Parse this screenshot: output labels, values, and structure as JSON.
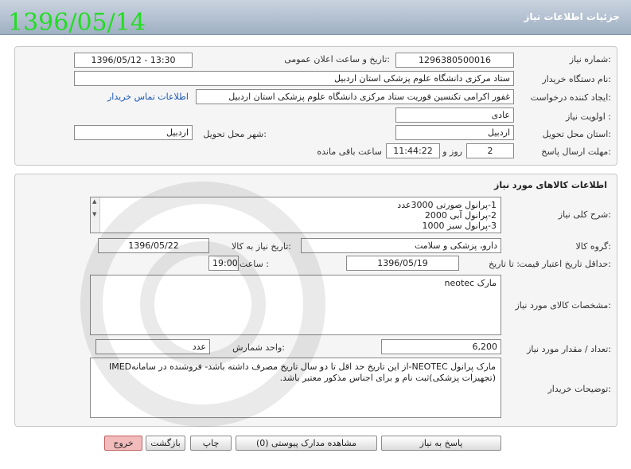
{
  "window": {
    "title": "جزئیات اطلاعات نیاز",
    "date_stamp": "1396/05/14"
  },
  "need": {
    "need_number_label": "شماره نیاز:",
    "need_number": "1296380500016",
    "announce_label": "تاریخ و ساعت اعلان عمومی:",
    "announce_value": "1396/05/12 - 13:30",
    "buyer_org_label": "نام دستگاه خریدار:",
    "buyer_org": "ستاد مرکزی دانشگاه علوم پزشکی استان اردبیل",
    "requester_label": "ایجاد کننده درخواست:",
    "requester": "غفور اکرامی تکنسین فوریت ستاد مرکزی دانشگاه علوم پزشکی استان اردبیل",
    "contact_link": "اطلاعات تماس خریدار",
    "priority_label": "اولویت نیاز :",
    "priority": "عادی",
    "province_label": "استان محل تحویل:",
    "province": "اردبیل",
    "city_label": "شهر محل تحویل:",
    "city": "اردبیل",
    "deadline_label": "مهلت ارسال پاسخ:",
    "days": "2",
    "days_word": "روز و",
    "time_left": "11:44:22",
    "remaining_word": "ساعت باقی مانده"
  },
  "goods": {
    "section_title": "اطلاعات کالاهای مورد نیاز",
    "summary_label": "شرح کلی نیاز:",
    "summary_lines": [
      "1-پرانول صورتی 3000عدد",
      "2-پرانول آبی 2000",
      "3-پرانول سبز 1000"
    ],
    "group_label": "گروه کالا:",
    "group": "دارو، پزشکی و سلامت",
    "need_date_label": "تاریخ نیاز به کالا:",
    "need_date": "1396/05/22",
    "validity_label": "حداقل تاریخ اعتبار قیمت:",
    "until_date_label": "تا تاریخ :",
    "until_date": "1396/05/19",
    "hour_label": "ساعت :",
    "hour": "19:00",
    "specs_label": "مشخصات کالای مورد نیاز:",
    "specs": "مارک neotec",
    "qty_label": "تعداد / مقدار مورد نیاز:",
    "qty": "6,200",
    "unit_label": "واحد شمارش:",
    "unit": "عدد",
    "buyer_notes_label": "توضیحات خریدار:",
    "buyer_notes": "مارک پرانول NEOTEC-از این تاریخ حد اقل تا دو سال تاریخ مصرف داشته باشد- فروشنده در سامانهIMED (تجهیزات پزشکی)ثبت نام و برای اجناس مذکور معتبر باشد."
  },
  "buttons": {
    "reply": "پاسخ به نیاز",
    "attachments": "مشاهده مدارک پیوستی (0)",
    "print": "چاپ",
    "back": "بازگشت",
    "exit": "خروج"
  }
}
